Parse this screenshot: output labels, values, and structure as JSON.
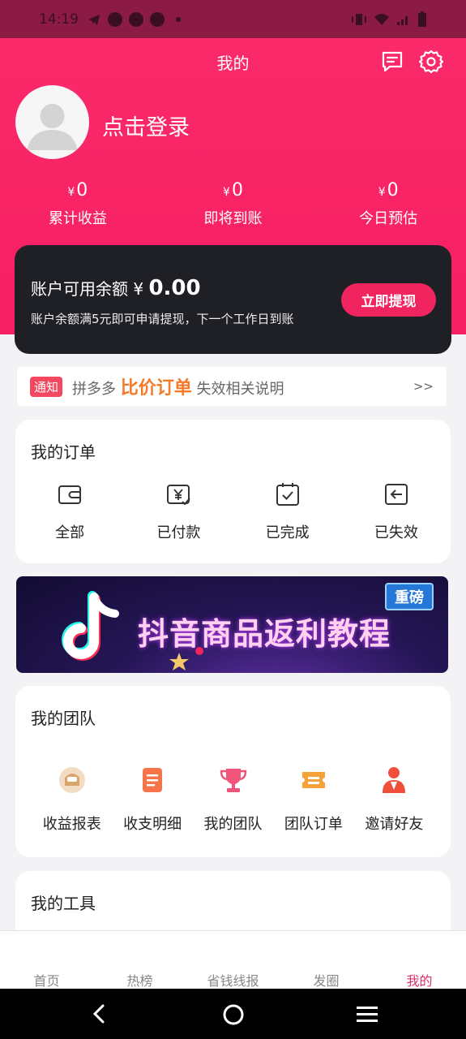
{
  "status": {
    "time": "14:19"
  },
  "header": {
    "title": "我的",
    "login": "点击登录"
  },
  "stats": [
    {
      "currency": "¥",
      "value": "0",
      "label": "累计收益"
    },
    {
      "currency": "¥",
      "value": "0",
      "label": "即将到账"
    },
    {
      "currency": "¥",
      "value": "0",
      "label": "今日预估"
    }
  ],
  "balance": {
    "label": "账户可用余额 ¥",
    "amount": "0.00",
    "note": "账户余额满5元即可申请提现，下一个工作日到账",
    "button": "立即提现"
  },
  "notice": {
    "tag": "通知",
    "pre": "拼多多",
    "strong": "比价订单",
    "post": "失效相关说明",
    "arrow": ">>"
  },
  "orders": {
    "title": "我的订单",
    "items": [
      {
        "label": "全部",
        "icon": "wallet-icon"
      },
      {
        "label": "已付款",
        "icon": "yuan-check-icon"
      },
      {
        "label": "已完成",
        "icon": "done-icon"
      },
      {
        "label": "已失效",
        "icon": "expired-icon"
      }
    ]
  },
  "banner": {
    "text": "抖音商品返利教程",
    "badge": "重磅"
  },
  "team": {
    "title": "我的团队",
    "items": [
      {
        "label": "收益报表",
        "icon": "income-report-icon",
        "color": "#d8a46c"
      },
      {
        "label": "收支明细",
        "icon": "detail-icon",
        "color": "#f5744a"
      },
      {
        "label": "我的团队",
        "icon": "trophy-icon",
        "color": "#f05478"
      },
      {
        "label": "团队订单",
        "icon": "ticket-icon",
        "color": "#f6a13a"
      },
      {
        "label": "邀请好友",
        "icon": "invite-icon",
        "color": "#f04f3b"
      }
    ]
  },
  "tools": {
    "title": "我的工具"
  },
  "nav": [
    {
      "label": "首页"
    },
    {
      "label": "热榜"
    },
    {
      "label": "省钱线报"
    },
    {
      "label": "发圈"
    },
    {
      "label": "我的"
    }
  ],
  "colors": {
    "brand": "#f51f63",
    "card_dark": "#1f1f26"
  }
}
